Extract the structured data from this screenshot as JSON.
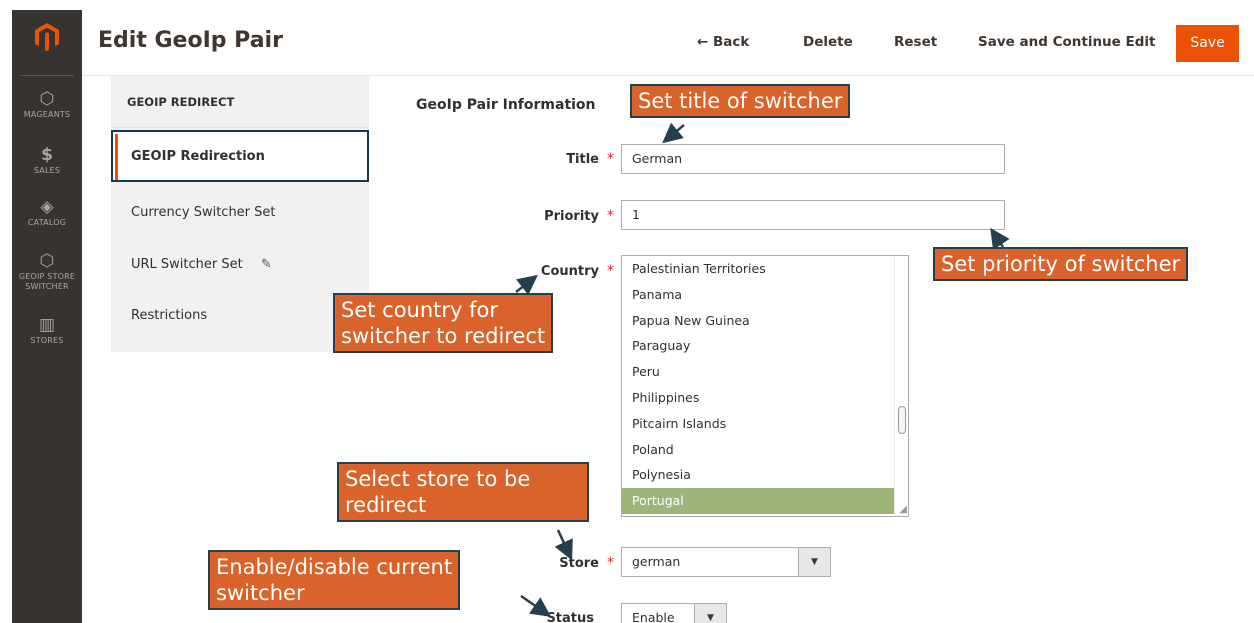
{
  "app": {
    "page_title": "Edit GeoIp Pair"
  },
  "header": {
    "back_label": "← Back",
    "delete_label": "Delete",
    "reset_label": "Reset",
    "save_continue_label": "Save and Continue Edit",
    "save_label": "Save"
  },
  "menu": {
    "items": [
      {
        "label": "MAGEANTS",
        "icon": "hexagon-icon"
      },
      {
        "label": "SALES",
        "icon": "dollar-icon"
      },
      {
        "label": "CATALOG",
        "icon": "box-icon"
      },
      {
        "label": "GEOIP STORE SWITCHER",
        "icon": "hexagon-icon"
      },
      {
        "label": "STORES",
        "icon": "store-icon"
      }
    ]
  },
  "tabs": {
    "heading": "GEOIP REDIRECT",
    "items": [
      "GEOIP Redirection",
      "Currency Switcher Set",
      "URL Switcher Set",
      "Restrictions"
    ]
  },
  "form": {
    "fieldset_title": "GeoIp Pair Information",
    "title_label": "Title",
    "title_value": "German",
    "priority_label": "Priority",
    "priority_value": "1",
    "country_label": "Country",
    "country_options": [
      "Palestinian Territories",
      "Panama",
      "Papua New Guinea",
      "Paraguay",
      "Peru",
      "Philippines",
      "Pitcairn Islands",
      "Poland",
      "Polynesia",
      "Portugal"
    ],
    "country_selected": "Portugal",
    "store_label": "Store",
    "store_value": "german",
    "status_label": "Status",
    "status_value": "Enable",
    "required_mark": "*"
  },
  "callouts": {
    "title": "Set title of switcher",
    "priority": "Set priority of switcher",
    "country_line1": "Set country for",
    "country_line2": "switcher to redirect",
    "store_line1": "Select store to be",
    "store_line2": "redirect",
    "status_line1": "Enable/disable current",
    "status_line2": "switcher"
  },
  "colors": {
    "accent": "#eb5202",
    "menu_bg": "#373330",
    "callout_bg": "#d9632a",
    "callout_border": "#24404f",
    "selected_option": "#9bb678"
  }
}
